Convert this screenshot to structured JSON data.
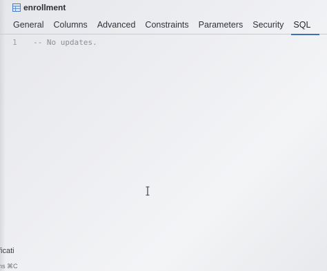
{
  "window": {
    "title": "enrollment",
    "title_icon": "table-icon"
  },
  "tabs": [
    {
      "label": "General",
      "active": false
    },
    {
      "label": "Columns",
      "active": false
    },
    {
      "label": "Advanced",
      "active": false
    },
    {
      "label": "Constraints",
      "active": false
    },
    {
      "label": "Parameters",
      "active": false
    },
    {
      "label": "Security",
      "active": false
    },
    {
      "label": "SQL",
      "active": true
    }
  ],
  "editor": {
    "line_number": "1",
    "content": "-- No updates."
  },
  "left_panel": {
    "label_fragment": "ficati",
    "sub_fragment": "ns ⌘C"
  },
  "colors": {
    "accent": "#3c6fb3",
    "text": "#2f323a",
    "comment": "#8b8e96"
  }
}
